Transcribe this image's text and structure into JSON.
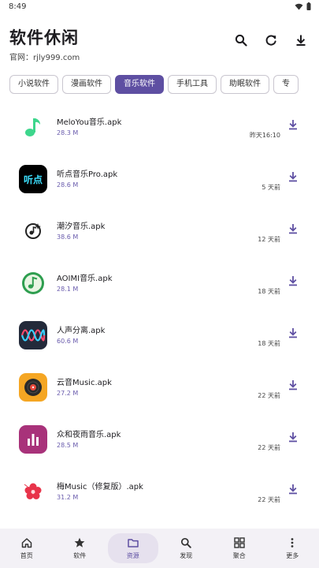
{
  "status": {
    "time": "8:49"
  },
  "app": {
    "title": "软件休闲",
    "subtitle": "官网：rjly999.com"
  },
  "header": {
    "actions": [
      "search-icon",
      "refresh-icon",
      "download-icon"
    ]
  },
  "categories": [
    "小说软件",
    "漫画软件",
    "音乐软件",
    "手机工具",
    "助眠软件",
    "专"
  ],
  "active_category": "音乐软件",
  "files": [
    {
      "name": "MeloYou音乐.apk",
      "size": "28.3 M",
      "time": "昨天16:10",
      "icon": "music-note-icon"
    },
    {
      "name": "听点音乐Pro.apk",
      "size": "28.6 M",
      "time": "5 天前",
      "icon": "tingdian-logo-icon",
      "icon_text": "听点"
    },
    {
      "name": "潮汐音乐.apk",
      "size": "38.6 M",
      "time": "12 天前",
      "icon": "tide-music-icon"
    },
    {
      "name": "AOIMI音乐.apk",
      "size": "28.1 M",
      "time": "18 天前",
      "icon": "aoimi-music-icon"
    },
    {
      "name": "人声分离.apk",
      "size": "60.6 M",
      "time": "18 天前",
      "icon": "waveform-icon"
    },
    {
      "name": "云音Music.apk",
      "size": "27.2 M",
      "time": "22 天前",
      "icon": "vinyl-record-icon"
    },
    {
      "name": "众和夜雨音乐.apk",
      "size": "28.5 M",
      "time": "22 天前",
      "icon": "equalizer-bars-icon"
    },
    {
      "name": "梅Music（修复版）.apk",
      "size": "31.2 M",
      "time": "22 天前",
      "icon": "plum-blossom-icon"
    }
  ],
  "bottom_nav": [
    {
      "label": "首页",
      "icon": "home-icon"
    },
    {
      "label": "软件",
      "icon": "star-icon"
    },
    {
      "label": "资源",
      "icon": "folder-icon",
      "active": true
    },
    {
      "label": "发现",
      "icon": "search-icon"
    },
    {
      "label": "聚合",
      "icon": "grid-icon"
    },
    {
      "label": "更多",
      "icon": "more-vertical-icon"
    }
  ],
  "colors": {
    "accent": "#5e4fa2",
    "nav_bg": "#f3f1f6",
    "size_text": "#6a5cad"
  }
}
